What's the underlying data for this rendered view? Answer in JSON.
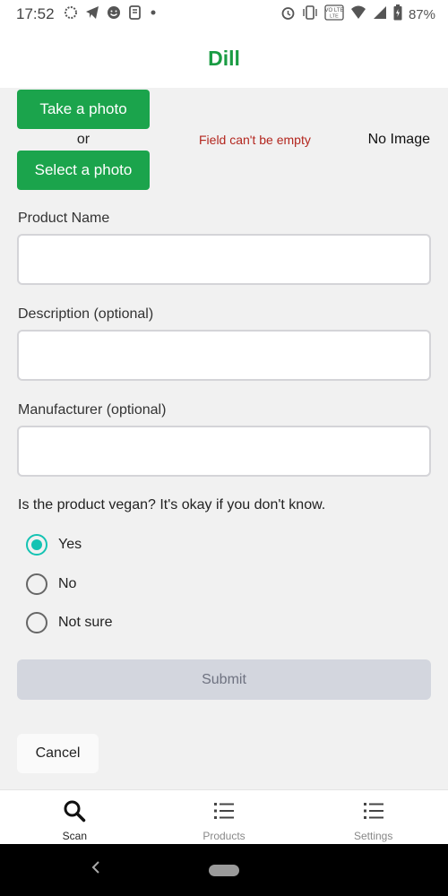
{
  "status_bar": {
    "time": "17:52",
    "left_icons": [
      "signal-messenger-icon",
      "telegram-icon",
      "smiley-icon",
      "notes-icon",
      "dot-icon"
    ],
    "right_icons": [
      "alarm-icon",
      "vibrate-icon",
      "volte-icon",
      "wifi-icon",
      "cell-signal-icon",
      "battery-icon"
    ],
    "volte_text": "VO LTE",
    "battery": "87%"
  },
  "header": {
    "title": "Dill"
  },
  "photo": {
    "take_label": "Take a photo",
    "or_label": "or",
    "select_label": "Select a photo",
    "error": "Field can't be empty",
    "no_image": "No Image"
  },
  "form": {
    "product_name": {
      "label": "Product Name",
      "value": ""
    },
    "description": {
      "label": "Description (optional)",
      "value": ""
    },
    "manufacturer": {
      "label": "Manufacturer (optional)",
      "value": ""
    },
    "vegan_question": "Is the product vegan? It's okay if you don't know.",
    "options": [
      {
        "label": "Yes",
        "selected": true
      },
      {
        "label": "No",
        "selected": false
      },
      {
        "label": "Not sure",
        "selected": false
      }
    ],
    "submit_label": "Submit",
    "cancel_label": "Cancel"
  },
  "bottom_nav": {
    "items": [
      {
        "label": "Scan",
        "icon": "search-icon",
        "active": true
      },
      {
        "label": "Products",
        "icon": "list-icon",
        "active": false
      },
      {
        "label": "Settings",
        "icon": "list-icon",
        "active": false
      }
    ]
  },
  "colors": {
    "brand_green": "#1ba44c",
    "title_green": "#1a9c43",
    "error_red": "#b3261e",
    "radio_teal": "#14c3b3"
  }
}
